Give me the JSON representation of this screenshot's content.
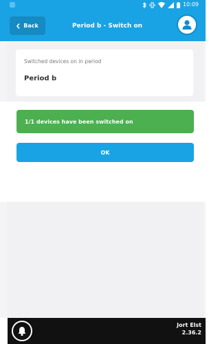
{
  "status_bar": {
    "time": "10:09",
    "icons": [
      "bluetooth-icon",
      "vibrate-icon",
      "wifi-icon",
      "signal-icon",
      "battery-icon"
    ]
  },
  "header": {
    "back_label": "Back",
    "title": "Period b - Switch on",
    "background_color": "#1aa3e4"
  },
  "card": {
    "label": "Switched devices on in period",
    "value": "Period b"
  },
  "dialog": {
    "message": "1/1 devices have been switched on",
    "message_color": "#4caf50",
    "ok_label": "OK"
  },
  "footer": {
    "user_name": "Jort Elst",
    "version": "2.36.2"
  }
}
